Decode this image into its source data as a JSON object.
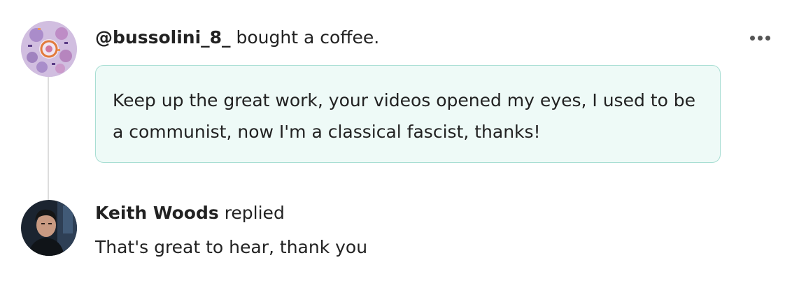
{
  "post": {
    "supporter_name": "@bussolini_8_",
    "action_text": "bought a coffee.",
    "message": "Keep up the great work, your videos opened my eyes, I used to be a communist, now I'm a classical fascist, thanks!",
    "more_icon": "more-horizontal-icon"
  },
  "reply": {
    "creator_name": "Keith Woods",
    "replied_label": "replied",
    "text": "That's great to hear, thank you"
  },
  "colors": {
    "message_background": "#eefaf7",
    "message_border": "#a8ded3",
    "thread_line": "#dddddd",
    "text": "#222222"
  }
}
